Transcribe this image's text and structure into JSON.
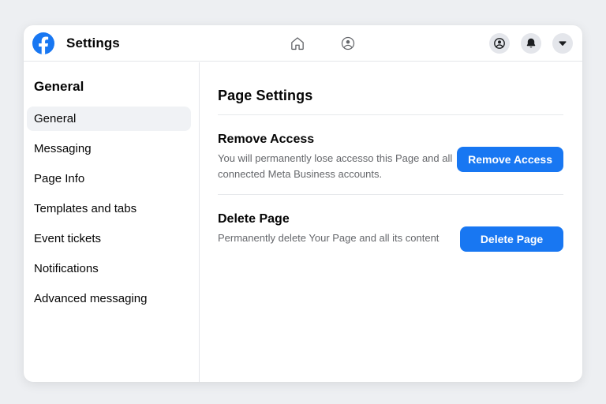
{
  "header": {
    "title": "Settings",
    "nav_icons": [
      "home-icon",
      "profile-icon"
    ],
    "action_icons": [
      "account-icon",
      "notifications-bell-icon",
      "chevron-down-icon"
    ]
  },
  "sidebar": {
    "heading": "General",
    "items": [
      {
        "label": "General",
        "selected": true
      },
      {
        "label": "Messaging",
        "selected": false
      },
      {
        "label": "Page Info",
        "selected": false
      },
      {
        "label": "Templates and tabs",
        "selected": false
      },
      {
        "label": "Event tickets",
        "selected": false
      },
      {
        "label": "Notifications",
        "selected": false
      },
      {
        "label": "Advanced messaging",
        "selected": false
      }
    ]
  },
  "main": {
    "title": "Page Settings",
    "sections": [
      {
        "heading": "Remove Access",
        "description": "You will permanently lose accesso this Page and all connected Meta Business accounts.",
        "button_label": "Remove Access"
      },
      {
        "heading": "Delete Page",
        "description": "Permanently delete Your Page and all its content",
        "button_label": "Delete Page"
      }
    ]
  },
  "colors": {
    "accent_blue": "#1877f2",
    "selected_item_bg": "#f0f2f5",
    "divider": "#e4e6ea",
    "secondary_text": "#65676b",
    "page_background": "#edeff2"
  }
}
